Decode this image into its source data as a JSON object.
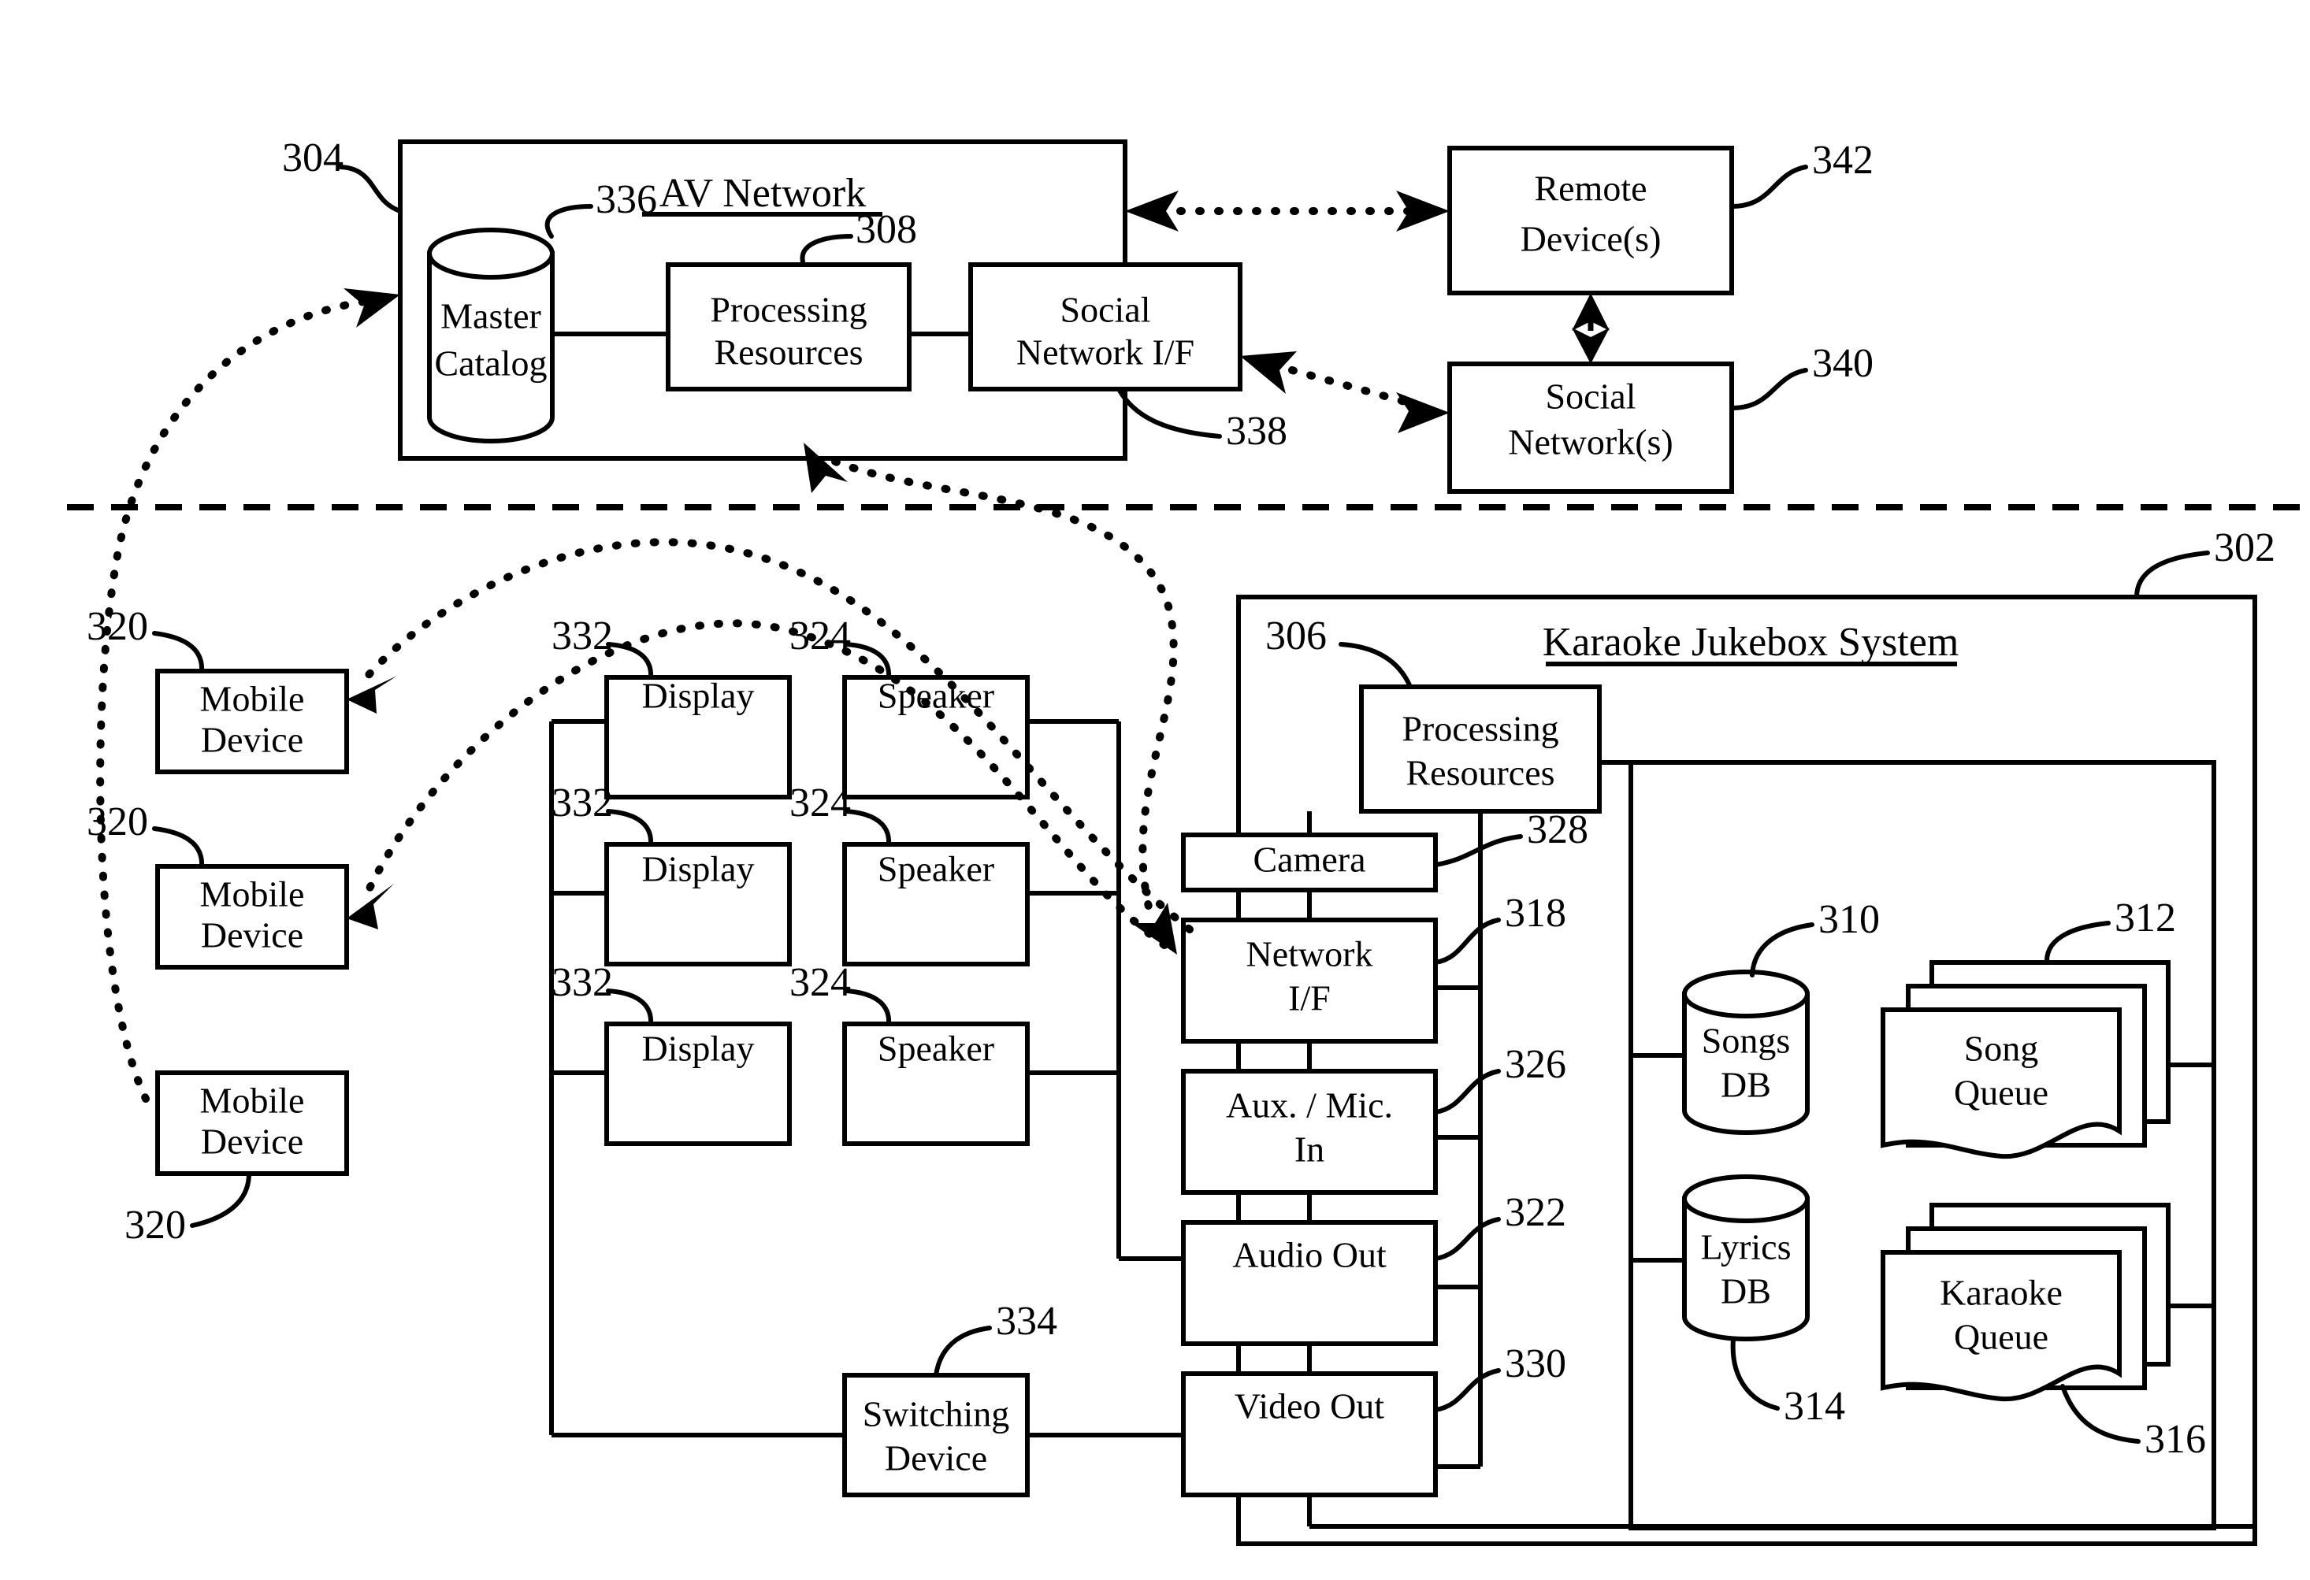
{
  "figure": {
    "type": "patent-block-diagram",
    "title_av": "AV Network",
    "title_kjs": "Karaoke Jukebox System"
  },
  "av_network": {
    "ref": "304",
    "title": "AV Network",
    "blocks": [
      {
        "ref": "336",
        "label_line1": "Master",
        "label_line2": "Catalog",
        "shape": "cylinder"
      },
      {
        "ref": "308",
        "label_line1": "Processing",
        "label_line2": "Resources",
        "shape": "box"
      },
      {
        "ref": "338",
        "label_line1": "Social",
        "label_line2": "Network I/F",
        "shape": "box"
      }
    ]
  },
  "external": {
    "remote_device": {
      "ref": "342",
      "label_line1": "Remote",
      "label_line2": "Device(s)"
    },
    "social_network": {
      "ref": "340",
      "label_line1": "Social",
      "label_line2": "Network(s)"
    }
  },
  "mobile_devices": [
    {
      "ref": "320",
      "label_line1": "Mobile",
      "label_line2": "Device"
    },
    {
      "ref": "320",
      "label_line1": "Mobile",
      "label_line2": "Device"
    },
    {
      "ref": "320",
      "label_line1": "Mobile",
      "label_line2": "Device"
    }
  ],
  "displays": [
    {
      "ref": "332",
      "label": "Display"
    },
    {
      "ref": "332",
      "label": "Display"
    },
    {
      "ref": "332",
      "label": "Display"
    }
  ],
  "speakers": [
    {
      "ref": "324",
      "label": "Speaker"
    },
    {
      "ref": "324",
      "label": "Speaker"
    },
    {
      "ref": "324",
      "label": "Speaker"
    }
  ],
  "switching_device": {
    "ref": "334",
    "label_line1": "Switching",
    "label_line2": "Device"
  },
  "io_blocks": [
    {
      "ref": "328",
      "label_line1": "Camera",
      "label_line2": ""
    },
    {
      "ref": "318",
      "label_line1": "Network",
      "label_line2": "I/F"
    },
    {
      "ref": "326",
      "label_line1": "Aux. / Mic.",
      "label_line2": "In"
    },
    {
      "ref": "322",
      "label_line1": "Audio Out",
      "label_line2": ""
    },
    {
      "ref": "330",
      "label_line1": "Video Out",
      "label_line2": ""
    }
  ],
  "karaoke_system": {
    "ref": "302",
    "title": "Karaoke Jukebox System",
    "processing": {
      "ref": "306",
      "label_line1": "Processing",
      "label_line2": "Resources"
    },
    "stores": [
      {
        "ref": "310",
        "label_line1": "Songs",
        "label_line2": "DB",
        "shape": "cylinder"
      },
      {
        "ref": "312",
        "label_line1": "Song",
        "label_line2": "Queue",
        "shape": "document-stack"
      },
      {
        "ref": "314",
        "label_line1": "Lyrics",
        "label_line2": "DB",
        "shape": "cylinder"
      },
      {
        "ref": "316",
        "label_line1": "Karaoke",
        "label_line2": "Queue",
        "shape": "document-stack"
      }
    ]
  },
  "colors": {
    "line": "#000000",
    "fill": "#ffffff"
  }
}
